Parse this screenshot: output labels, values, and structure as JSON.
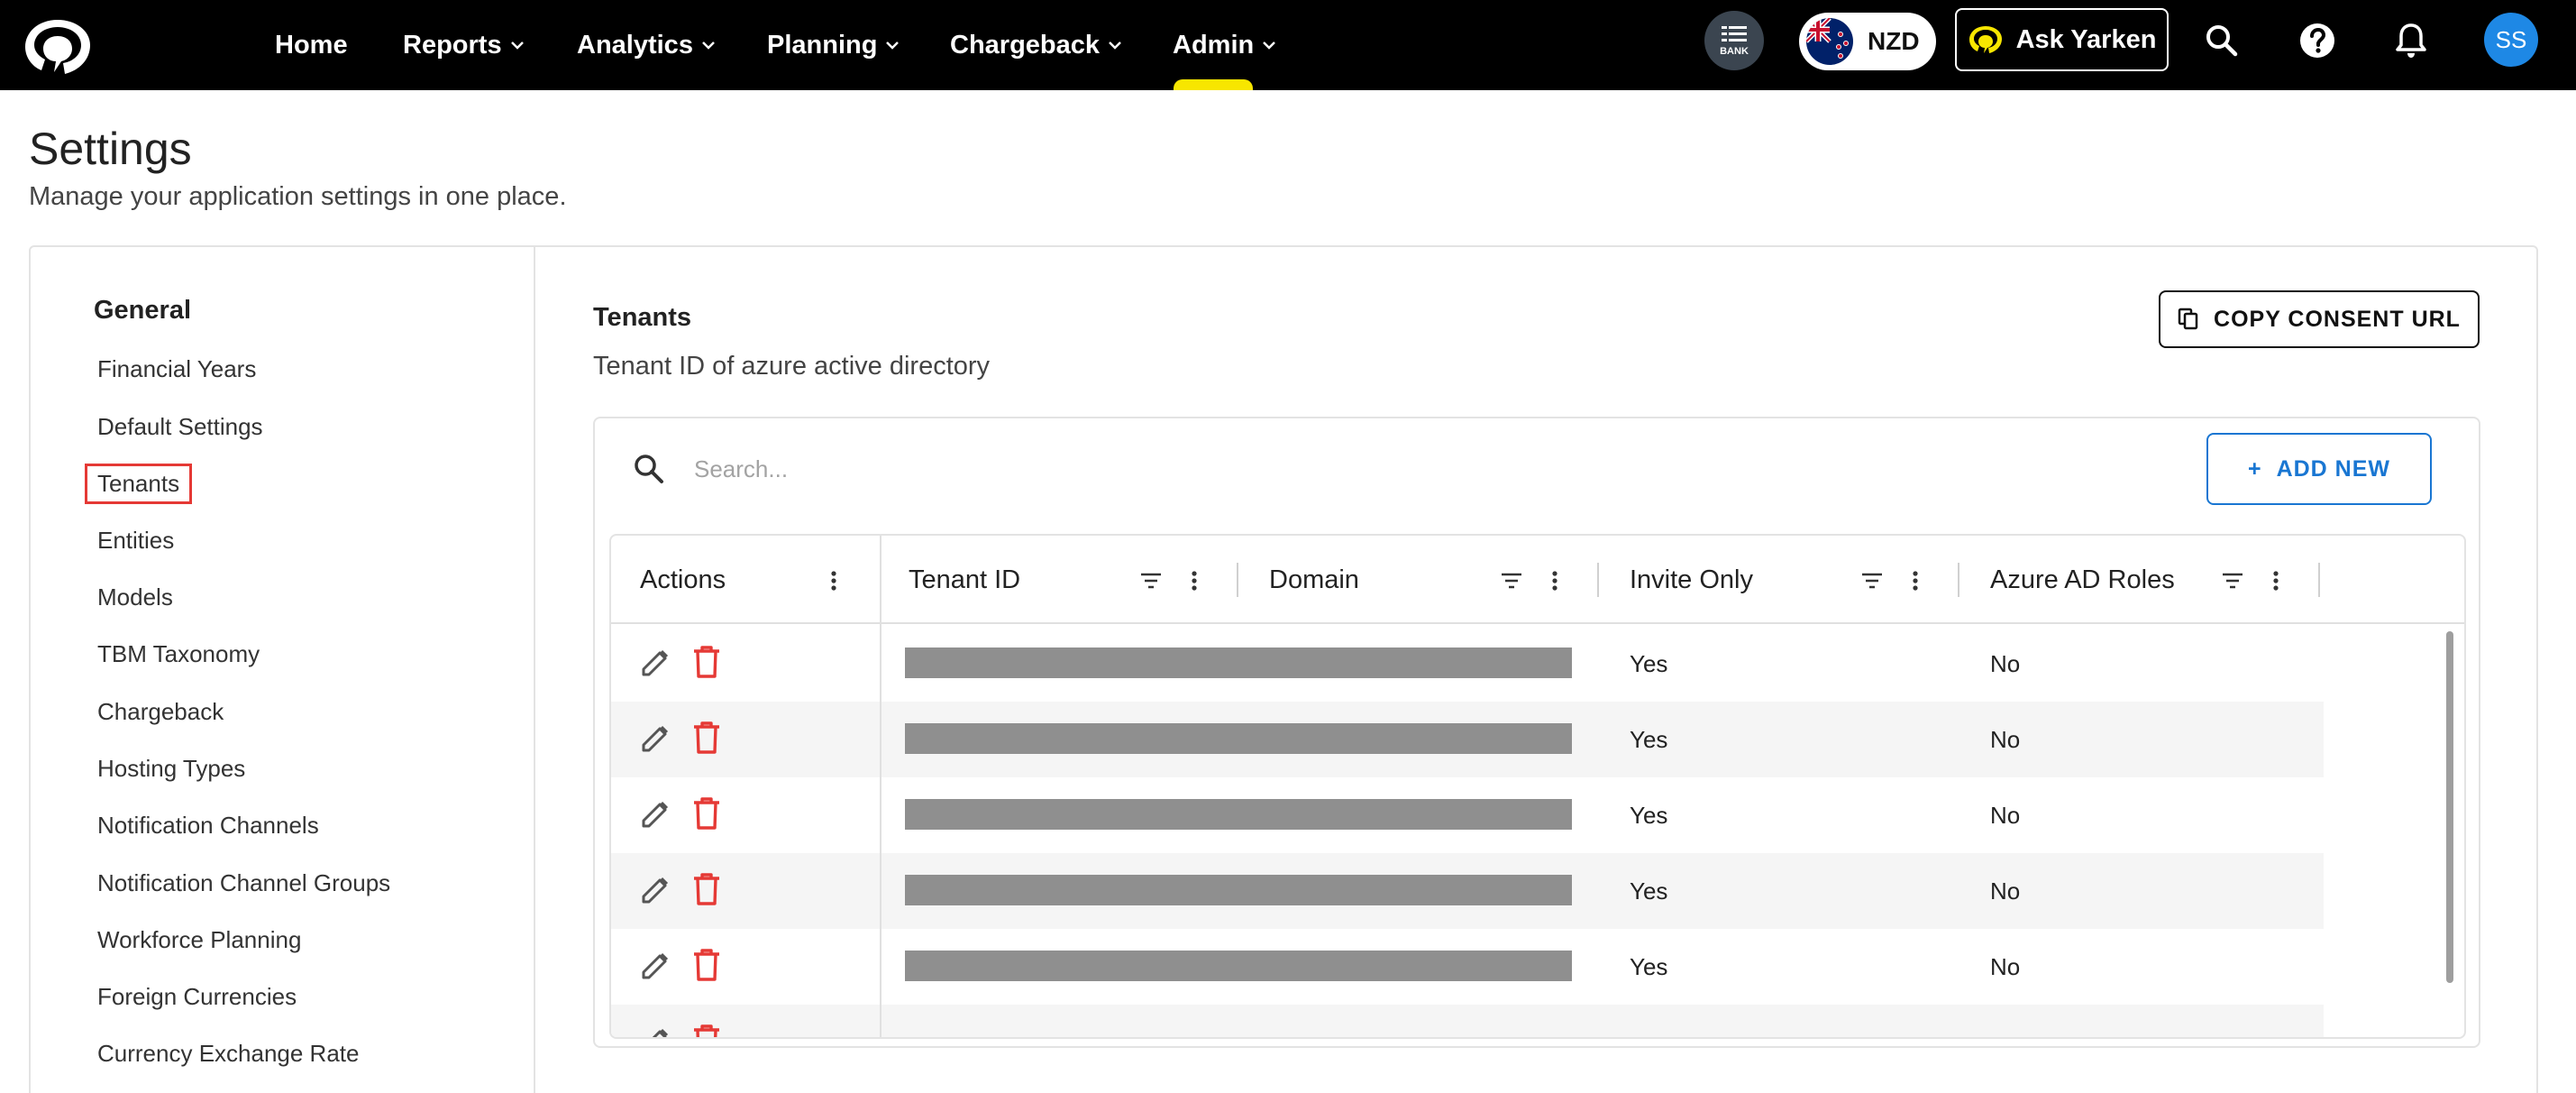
{
  "nav": {
    "logo_icon": "yarken-logo",
    "items": [
      {
        "label": "Home",
        "has_dropdown": false
      },
      {
        "label": "Reports",
        "has_dropdown": true
      },
      {
        "label": "Analytics",
        "has_dropdown": true
      },
      {
        "label": "Planning",
        "has_dropdown": true
      },
      {
        "label": "Chargeback",
        "has_dropdown": true
      },
      {
        "label": "Admin",
        "has_dropdown": true
      }
    ],
    "active_item": "Admin",
    "bank_label": "BANK",
    "currency_code": "NZD",
    "ask_label": "Ask Yarken",
    "avatar_initials": "SS",
    "accent_color": "#f7e600"
  },
  "page": {
    "title": "Settings",
    "subtitle": "Manage your application settings in one place."
  },
  "sidebar": {
    "heading": "General",
    "items": [
      {
        "label": "Financial Years"
      },
      {
        "label": "Default Settings"
      },
      {
        "label": "Tenants",
        "selected": true
      },
      {
        "label": "Entities"
      },
      {
        "label": "Models"
      },
      {
        "label": "TBM Taxonomy"
      },
      {
        "label": "Chargeback"
      },
      {
        "label": "Hosting Types"
      },
      {
        "label": "Notification Channels"
      },
      {
        "label": "Notification Channel Groups"
      },
      {
        "label": "Workforce Planning"
      },
      {
        "label": "Foreign Currencies"
      },
      {
        "label": "Currency Exchange Rate"
      }
    ]
  },
  "section": {
    "title": "Tenants",
    "description": "Tenant ID of azure active directory",
    "copy_button": "COPY CONSENT URL",
    "search_placeholder": "Search...",
    "add_button": "ADD NEW",
    "add_icon": "+"
  },
  "table": {
    "columns": [
      "Actions",
      "Tenant ID",
      "Domain",
      "Invite Only",
      "Azure AD Roles"
    ],
    "rows": [
      {
        "tenant_id": "[redacted]",
        "domain": "[redacted]",
        "invite_only": "Yes",
        "azure_ad_roles": "No"
      },
      {
        "tenant_id": "[redacted]",
        "domain": "[redacted]",
        "invite_only": "Yes",
        "azure_ad_roles": "No"
      },
      {
        "tenant_id": "[redacted]",
        "domain": "[redacted]",
        "invite_only": "Yes",
        "azure_ad_roles": "No"
      },
      {
        "tenant_id": "[redacted]",
        "domain": "[redacted]",
        "invite_only": "Yes",
        "azure_ad_roles": "No"
      },
      {
        "tenant_id": "[redacted]",
        "domain": "[redacted]",
        "invite_only": "Yes",
        "azure_ad_roles": "No"
      }
    ],
    "delete_color": "#e53935"
  }
}
